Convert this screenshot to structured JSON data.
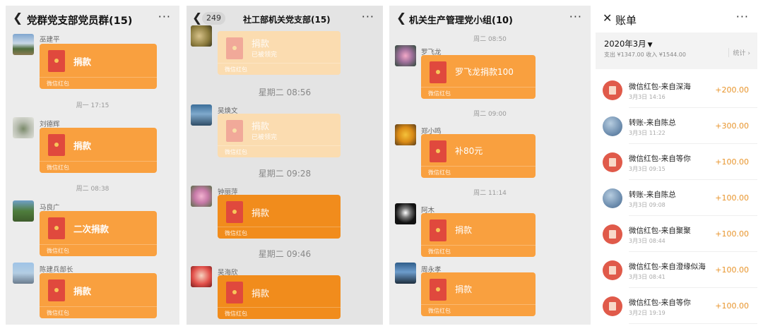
{
  "panel1": {
    "title": "党群党支部党员群(15)",
    "timestamps": [
      "周一 17:15",
      "周二 08:38"
    ],
    "messages": [
      {
        "sender": "巫建平",
        "text": "捐款",
        "footer": "微信红包"
      },
      {
        "sender": "刘德辉",
        "text": "捐款",
        "footer": "微信红包"
      },
      {
        "sender": "马良广",
        "text": "二次捐款",
        "footer": "微信红包"
      },
      {
        "sender": "陈建兵部长",
        "text": "捐款",
        "footer": "微信红包"
      }
    ]
  },
  "panel2": {
    "badge": "249",
    "title": "社工部机关党支部(15)",
    "timestamps": [
      "星期二 08:56",
      "星期二 09:28",
      "星期二 09:46"
    ],
    "messages": [
      {
        "sender": "",
        "text": "捐款",
        "sub": "已被领完",
        "footer": "微信红包"
      },
      {
        "sender": "吴焕文",
        "text": "捐款",
        "sub": "已被领完",
        "footer": "微信红包"
      },
      {
        "sender": "钟丽萍",
        "text": "捐款",
        "footer": "微信红包"
      },
      {
        "sender": "吴海欣",
        "text": "捐款",
        "footer": "微信红包"
      }
    ]
  },
  "panel3": {
    "title": "机关生产管理党小组(10)",
    "timestamps": [
      "周二 08:50",
      "周二 09:00",
      "周二 11:14"
    ],
    "messages": [
      {
        "sender": "罗飞龙",
        "text": "罗飞龙捐款100",
        "footer": "微信红包"
      },
      {
        "sender": "郑小鸣",
        "text": "补80元",
        "footer": "微信红包"
      },
      {
        "sender": "阿木",
        "text": "捐款",
        "footer": "微信红包"
      },
      {
        "sender": "周永孝",
        "text": "捐款",
        "footer": "微信红包"
      }
    ]
  },
  "panel4": {
    "title": "账单",
    "month": "2020年3月",
    "totals": "支出 ¥1347.00 收入 ¥1544.00",
    "stats": "统计",
    "rows": [
      {
        "name": "微信红包-来自深海",
        "date": "3月3日 14:16",
        "amount": "+200.00",
        "icon": "red-packet-icon"
      },
      {
        "name": "转账-来自陈总",
        "date": "3月3日 11:22",
        "amount": "+300.00",
        "icon": "avatar"
      },
      {
        "name": "微信红包-来自等你",
        "date": "3月3日 09:15",
        "amount": "+100.00",
        "icon": "red-packet-icon"
      },
      {
        "name": "转账-来自陈总",
        "date": "3月3日 09:08",
        "amount": "+100.00",
        "icon": "avatar"
      },
      {
        "name": "微信红包-来自聚聚",
        "date": "3月3日 08:44",
        "amount": "+100.00",
        "icon": "red-packet-icon"
      },
      {
        "name": "微信红包-来自澄缘似海",
        "date": "3月3日 08:41",
        "amount": "+100.00",
        "icon": "red-packet-icon"
      },
      {
        "name": "微信红包-来自等你",
        "date": "3月2日 19:19",
        "amount": "+100.00",
        "icon": "red-packet-icon"
      }
    ]
  },
  "colors": {
    "packet": "#f9a03f",
    "packet_opened": "#fbdcb0",
    "packet_deep": "#f18c1c",
    "amount": "#e8952c"
  }
}
